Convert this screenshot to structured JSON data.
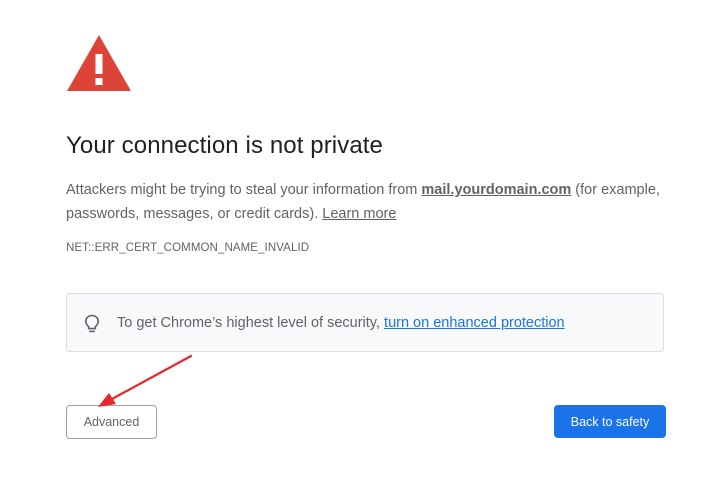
{
  "page": {
    "title": "Your connection is not private",
    "message": {
      "before": "Attackers might be trying to steal your information from ",
      "domain": "mail.yourdomain.com",
      "after": " (for example, passwords, messages, or credit cards). ",
      "learn_more": "Learn more"
    },
    "error_code": "NET::ERR_CERT_COMMON_NAME_INVALID"
  },
  "enhanced_protection": {
    "icon": "lightbulb-icon",
    "text": "To get Chrome’s highest level of security, ",
    "link": "turn on enhanced protection"
  },
  "buttons": {
    "advanced": "Advanced",
    "back_to_safety": "Back to safety"
  },
  "icons": {
    "warning": "warning-triangle-icon",
    "annotation": "red-arrow-annotation"
  },
  "colors": {
    "warning_red": "#db4437",
    "primary_blue": "#1a73e8",
    "annotation_red": "#e8262b"
  }
}
